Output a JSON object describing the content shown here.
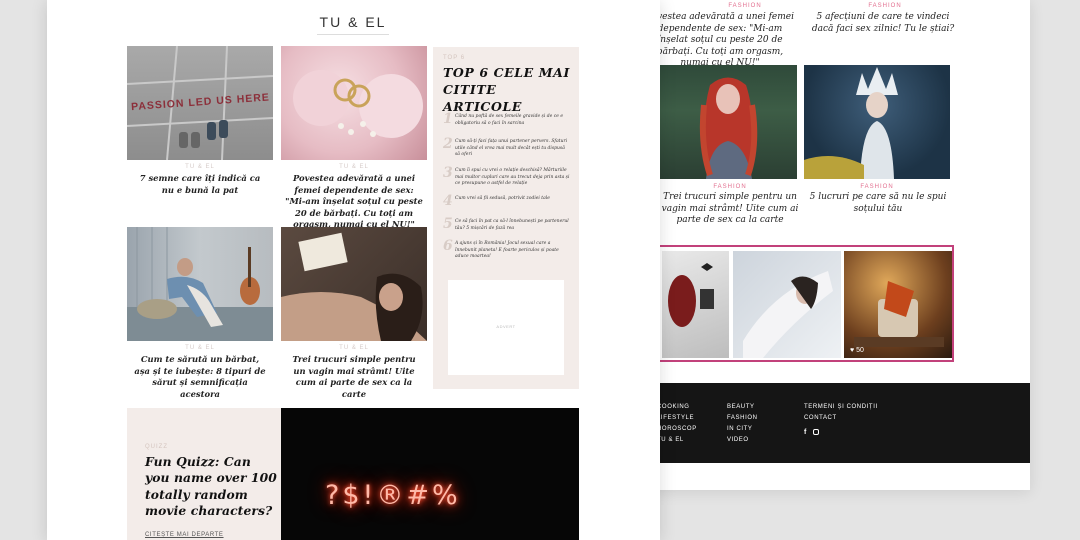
{
  "back": {
    "top_articles": [
      {
        "category": "FASHION",
        "title": "Povestea adevărată a unei femei dependente de sex: \"Mi-am înșelat soțul cu peste 20 de bărbați. Cu toți am orgasm, numai cu el NU!\""
      },
      {
        "category": "FASHION",
        "title": "5 afecțiuni de care te vindeci dacă faci sex zilnic! Tu le știai?"
      }
    ],
    "mid_articles": [
      {
        "category": "FASHION",
        "title": "Trei trucuri simple pentru un vagin mai strâmt! Uite cum ai parte de sex ca la carte"
      },
      {
        "category": "FASHION",
        "title": "5 lucruri pe care să nu le spui soțului tău"
      }
    ],
    "strip_likes": [
      "",
      "",
      "50"
    ],
    "footer": {
      "col1": [
        "COOKING",
        "LIFESTYLE",
        "HOROSCOP",
        "TU & EL"
      ],
      "col2": [
        "BEAUTY",
        "FASHION",
        "IN CITY",
        "VIDEO"
      ],
      "col3": [
        "TERMENI ȘI CONDIȚII",
        "CONTACT"
      ],
      "social_icons": [
        "facebook-icon",
        "instagram-icon"
      ]
    }
  },
  "front": {
    "section_title": "TU & EL",
    "articles": [
      {
        "category": "TU & EL",
        "title": "7 semne care îți indică ca nu e bună la pat",
        "image_text": "PASSION LED US HERE"
      },
      {
        "category": "TU & EL",
        "title": "Povestea adevărată a unei femei dependente de sex: \"Mi-am înșelat soțul cu peste 20 de bărbați. Cu toți am orgasm, numai cu el NU!\""
      },
      {
        "category": "TU & EL",
        "title": "Cum te sărută un bărbat, așa și te iubește: 8 tipuri de sărut și semnificația acestora"
      },
      {
        "category": "TU & EL",
        "title": "Trei trucuri simple pentru un vagin mai strâmt! Uite cum ai parte de sex ca la carte"
      }
    ],
    "top6": {
      "category": "TOP 6",
      "heading": "TOP 6 CELE MAI CITITE ARTICOLE",
      "items": [
        {
          "num": "1",
          "text": "Când nu poftă de sex femeile gravide și de ce e obligatoriu să o faci în sarcina"
        },
        {
          "num": "2",
          "text": "Cum să-ți faci fața unui partener pervers. Sfaturi utile când el vrea mai mult decât ești tu dispusă să oferi"
        },
        {
          "num": "3",
          "text": "Cum îi spui cu vrei o relație deschisă? Mărturiile mai multor cupluri care au trecut deja prin asta și ce presupune o astfel de relație"
        },
        {
          "num": "4",
          "text": "Cum vrei să fii sedusă, potrivit zodiei tale"
        },
        {
          "num": "5",
          "text": "Ce să faci în pat ca să-l înnebunești pe partenerul tău? 5 mișcări de fază rea"
        },
        {
          "num": "6",
          "text": "A ajuns și în România! Jocul sexual care a înnebunit planeta! E foarte periculos și poate aduce moartea!"
        }
      ],
      "ad_label": "ADVERT"
    },
    "quiz": {
      "category": "QUIZZ",
      "title": "Fun Quizz: Can you name over 100 totally random movie characters?",
      "link": "CITEȘTE MAI DEPARTE",
      "neon_text": "?$!®#%"
    }
  },
  "colors": {
    "accent": "#e26f8f",
    "frame": "#c2417b",
    "card_bg": "#f3ece9",
    "footer_bg": "#151515"
  }
}
